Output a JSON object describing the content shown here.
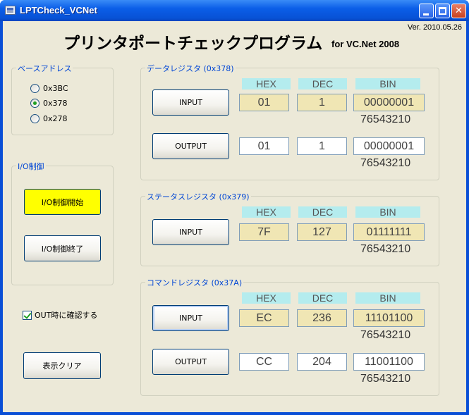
{
  "window": {
    "title": "LPTCheck_VCNet"
  },
  "header": {
    "version": "Ver. 2010.05.26",
    "title": "プリンタポートチェックプログラム",
    "subtitle": "for VC.Net 2008"
  },
  "base_address": {
    "label": "ベースアドレス",
    "options": [
      {
        "label": "0x3BC",
        "selected": false
      },
      {
        "label": "0x378",
        "selected": true
      },
      {
        "label": "0x278",
        "selected": false
      }
    ]
  },
  "io_control": {
    "label": "I/O制御",
    "start_label": "I/O制御開始",
    "end_label": "I/O制御終了"
  },
  "confirm_checkbox": {
    "label": "OUT時に確認する",
    "checked": true
  },
  "clear_label": "表示クリア",
  "columns": {
    "hex": "HEX",
    "dec": "DEC",
    "bin": "BIN"
  },
  "bit_order": "76543210",
  "data_register": {
    "label": "データレジスタ (0x378)",
    "input": {
      "button": "INPUT",
      "hex": "01",
      "dec": "1",
      "bin": "00000001"
    },
    "output": {
      "button": "OUTPUT",
      "hex": "01",
      "dec": "1",
      "bin": "00000001"
    }
  },
  "status_register": {
    "label": "ステータスレジスタ (0x379)",
    "input": {
      "button": "INPUT",
      "hex": "7F",
      "dec": "127",
      "bin": "01111111"
    }
  },
  "command_register": {
    "label": "コマンドレジスタ (0x37A)",
    "input": {
      "button": "INPUT",
      "hex": "EC",
      "dec": "236",
      "bin": "11101100"
    },
    "output": {
      "button": "OUTPUT",
      "hex": "CC",
      "dec": "204",
      "bin": "11001100"
    }
  },
  "colors": {
    "titlebar": "#0b5ee8",
    "window_bg": "#ece9d8",
    "group_label": "#0046d5",
    "header_cell": "#b4ecee",
    "readonly_cell": "#f0e6b4",
    "start_button": "#ffff00"
  }
}
